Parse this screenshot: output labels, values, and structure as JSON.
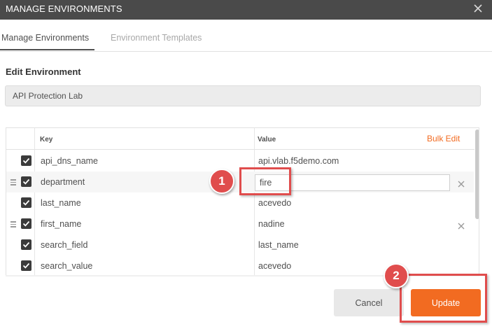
{
  "window": {
    "title": "MANAGE ENVIRONMENTS"
  },
  "tabs": [
    {
      "label": "Manage Environments",
      "active": true
    },
    {
      "label": "Environment Templates",
      "active": false
    }
  ],
  "edit": {
    "heading": "Edit Environment",
    "environment_name": "API Protection Lab"
  },
  "table": {
    "headers": {
      "key": "Key",
      "value": "Value",
      "bulk_edit": "Bulk Edit"
    },
    "rows": [
      {
        "key": "api_dns_name",
        "value": "api.vlab.f5demo.com",
        "enabled": true,
        "editing": false
      },
      {
        "key": "department",
        "value": "fire",
        "enabled": true,
        "editing": true
      },
      {
        "key": "last_name",
        "value": "acevedo",
        "enabled": true,
        "editing": false
      },
      {
        "key": "first_name",
        "value": "nadine",
        "enabled": true,
        "editing": false
      },
      {
        "key": "search_field",
        "value": "last_name",
        "enabled": true,
        "editing": false
      },
      {
        "key": "search_value",
        "value": "acevedo",
        "enabled": true,
        "editing": false
      }
    ]
  },
  "buttons": {
    "cancel": "Cancel",
    "update": "Update"
  },
  "annotations": {
    "marker1": "1",
    "marker2": "2"
  },
  "colors": {
    "accent": "#f26b21",
    "titlebar": "#4a4a4a",
    "callout": "#e04d4d"
  },
  "icons": {
    "close": "close-icon",
    "drag": "drag-handle-icon",
    "delete": "delete-row-icon",
    "check": "checkmark-icon"
  }
}
